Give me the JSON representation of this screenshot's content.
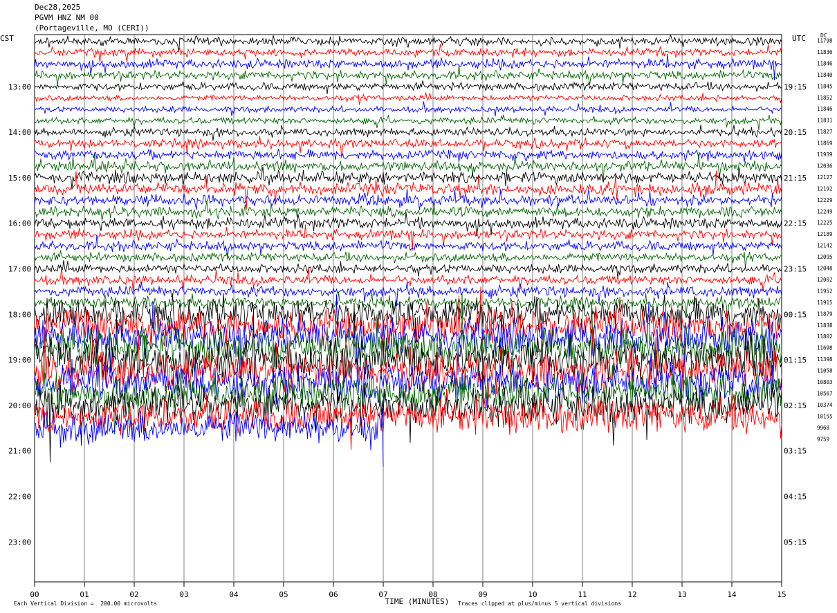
{
  "header": {
    "date": "Dec28,2025",
    "station": "PGVM HNZ NM 00",
    "location": "(Portageville, MO (CERI))"
  },
  "left_tz": "CST",
  "right_tz": "UTC",
  "dc_label": "DC",
  "footer": {
    "scale_note": "Each Vertical Division =  200.00 microvolts",
    "clip_note": "Traces clipped at plus/minus 5 vertical divisions"
  },
  "colors": {
    "trace_cycle": [
      "#000000",
      "#ff0000",
      "#0000ff",
      "#006400"
    ],
    "grid": "#808080"
  },
  "chart_data": {
    "type": "line",
    "title": "PGVM HNZ NM 00",
    "xlabel": "TIME (MINUTES)",
    "x_ticks": [
      "00",
      "01",
      "02",
      "03",
      "04",
      "05",
      "06",
      "07",
      "08",
      "09",
      "10",
      "11",
      "12",
      "13",
      "14",
      "15"
    ],
    "xlim": [
      0,
      15
    ],
    "left_time_labels": [
      "13:00",
      "14:00",
      "15:00",
      "16:00",
      "17:00",
      "18:00",
      "19:00",
      "20:00",
      "21:00",
      "22:00",
      "23:00"
    ],
    "right_time_labels": [
      "19:15",
      "20:15",
      "21:15",
      "22:15",
      "23:15",
      "00:15",
      "01:15",
      "02:15",
      "03:15",
      "04:15",
      "05:15"
    ],
    "dc_offsets": [
      "11798",
      "11836",
      "11846",
      "11840",
      "11845",
      "11852",
      "11846",
      "11831",
      "11827",
      "11869",
      "11939",
      "12036",
      "12127",
      "12192",
      "12229",
      "12249",
      "12225",
      "12189",
      "12142",
      "12095",
      "12048",
      "12002",
      "11952",
      "11915",
      "11879",
      "11838",
      "11802",
      "11698",
      "11398",
      "11058",
      "10803",
      "10567",
      "10374",
      "10155",
      "9968",
      "9759"
    ],
    "trace_amplitude_profile": [
      0.45,
      0.4,
      0.5,
      0.45,
      0.4,
      0.3,
      0.3,
      0.35,
      0.4,
      0.45,
      0.5,
      0.55,
      0.6,
      0.65,
      0.6,
      0.55,
      0.6,
      0.5,
      0.5,
      0.45,
      0.45,
      0.5,
      0.55,
      0.6,
      1.6,
      1.7,
      1.9,
      2.0,
      2.2,
      2.1,
      2.0,
      1.9,
      1.9,
      1.8,
      1.7,
      1.6
    ],
    "trace_minutes_recorded": [
      15,
      15,
      15,
      15,
      15,
      15,
      15,
      15,
      15,
      15,
      15,
      15,
      15,
      15,
      15,
      15,
      15,
      15,
      15,
      15,
      15,
      15,
      15,
      15,
      15,
      15,
      15,
      15,
      15,
      15,
      15,
      15,
      15,
      15,
      7,
      0
    ],
    "scale_microvolts_per_division": 200.0,
    "clip_divisions": 5
  }
}
